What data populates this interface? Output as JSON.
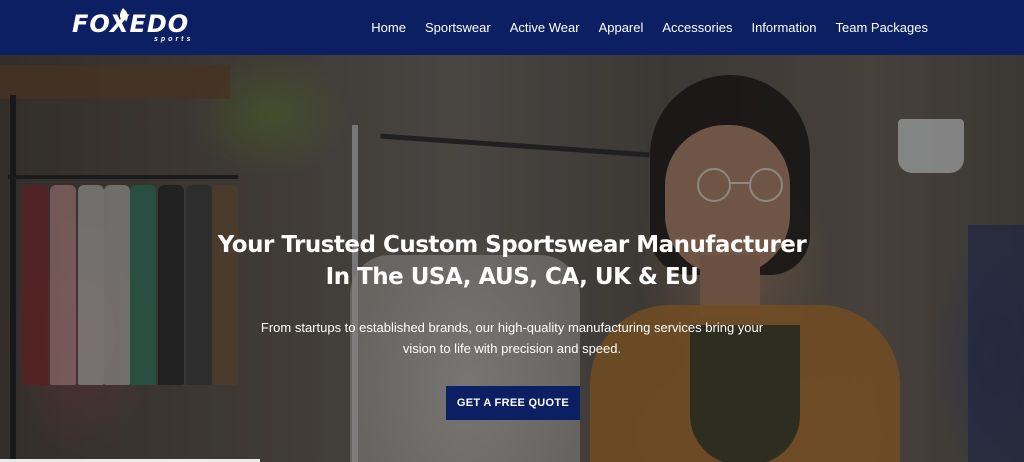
{
  "header": {
    "logo": {
      "wordmark": "FOXEDO",
      "sub": "sports"
    },
    "nav": [
      {
        "label": "Home"
      },
      {
        "label": "Sportswear"
      },
      {
        "label": "Active Wear"
      },
      {
        "label": "Apparel"
      },
      {
        "label": "Accessories"
      },
      {
        "label": "Information"
      },
      {
        "label": "Team Packages"
      }
    ]
  },
  "hero": {
    "title_line1": "Your Trusted Custom Sportswear Manufacturer",
    "title_line2": "In The USA, AUS, CA, UK & EU",
    "subtitle_line1": "From startups to established brands, our high-quality manufacturing services bring your",
    "subtitle_line2": "vision to life with precision and speed.",
    "cta_label": "GET A FREE QUOTE"
  },
  "colors": {
    "header_bg": "#0d1f63",
    "cta_bg": "#0d1f63",
    "text": "#ffffff"
  }
}
